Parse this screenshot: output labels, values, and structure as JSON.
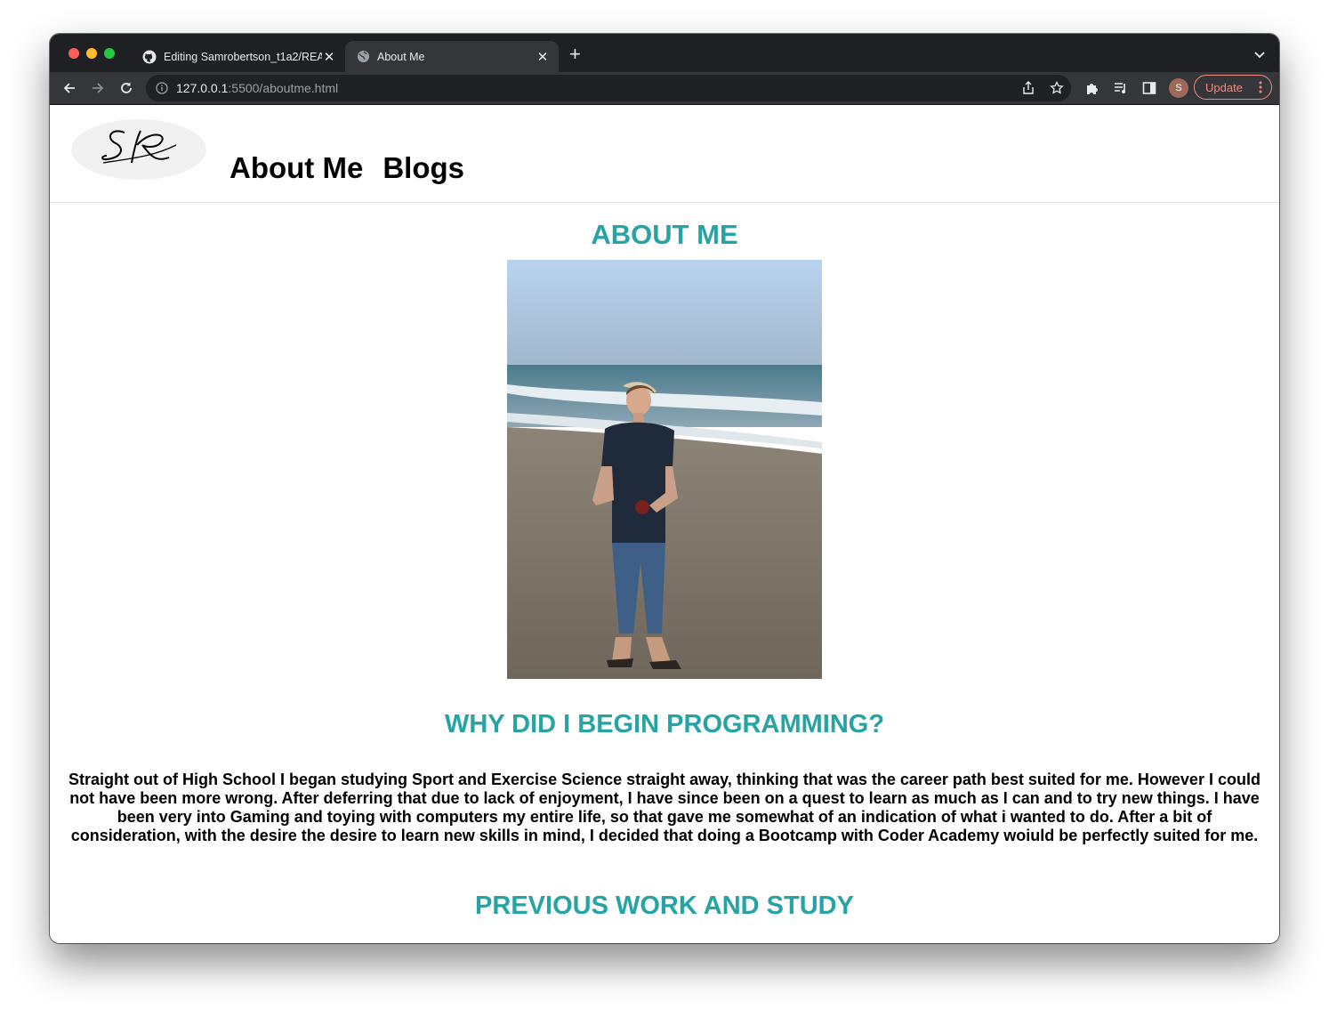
{
  "browser": {
    "tabs": [
      {
        "title": "Editing Samrobertson_t1a2/REA",
        "icon": "github-icon",
        "active": false
      },
      {
        "title": "About Me",
        "icon": "globe-icon",
        "active": true
      }
    ],
    "address": {
      "host": "127.0.0.1",
      "rest": ":5500/aboutme.html"
    },
    "profile_initial": "S",
    "update_label": "Update"
  },
  "site": {
    "nav": [
      "About Me",
      "Blogs"
    ],
    "logo_icon": "signature-logo-icon"
  },
  "content": {
    "about_heading": "ABOUT ME",
    "why_heading": "WHY DID I BEGIN PROGRAMMING?",
    "why_text": "Straight out of High School I began studying Sport and Exercise Science straight away, thinking that was the career path best suited for me. However I could not have been more wrong. After deferring that due to lack of enjoyment, I have since been on a quest to learn as much as I can and to try new things. I have been very into Gaming and toying with computers my entire life, so that gave me somewhat of an indication of what i wanted to do. After a bit of consideration, with the desire the desire to learn new skills in mind, I decided that doing a Bootcamp with Coder Academy woiuld be perfectly suited for me.",
    "prev_heading": "PREVIOUS WORK AND STUDY"
  },
  "colors": {
    "heading_accent": "#26a3a3",
    "update_accent": "#f28b82"
  }
}
